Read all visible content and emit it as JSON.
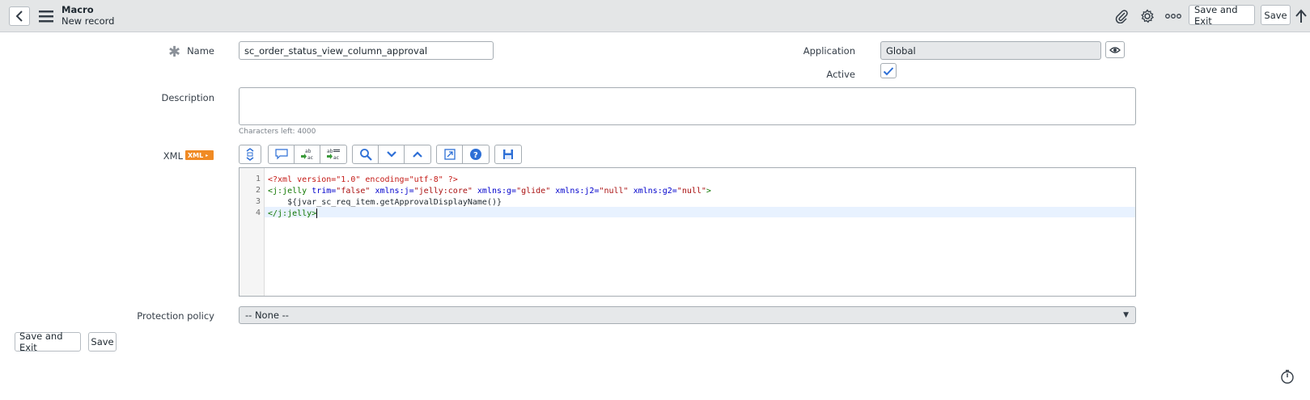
{
  "header": {
    "title": "Macro",
    "subtitle": "New record",
    "save_exit_label": "Save and Exit",
    "save_label": "Save"
  },
  "form": {
    "name_label": "Name",
    "name_value": "sc_order_status_view_column_approval",
    "application_label": "Application",
    "application_value": "Global",
    "active_label": "Active",
    "active_checked": true,
    "description_label": "Description",
    "description_value": "",
    "chars_left": "Characters left: 4000",
    "xml_label": "XML",
    "xml_badge": "XML",
    "protection_label": "Protection policy",
    "protection_value": "-- None --"
  },
  "editor": {
    "line_numbers": [
      "1",
      "2",
      "3",
      "4"
    ],
    "lines": [
      "<?xml version=\"1.0\" encoding=\"utf-8\" ?>",
      "<j:jelly trim=\"false\" xmlns:j=\"jelly:core\" xmlns:g=\"glide\" xmlns:j2=\"null\" xmlns:g2=\"null\">",
      "    ${jvar_sc_req_item.getApprovalDisplayName()}",
      "</j:jelly>"
    ]
  },
  "footer": {
    "save_exit_label": "Save and Exit",
    "save_label": "Save"
  },
  "colors": {
    "header_bg": "#e4e6e7",
    "accent": "#1f8476",
    "xml_badge": "#f08a24"
  }
}
